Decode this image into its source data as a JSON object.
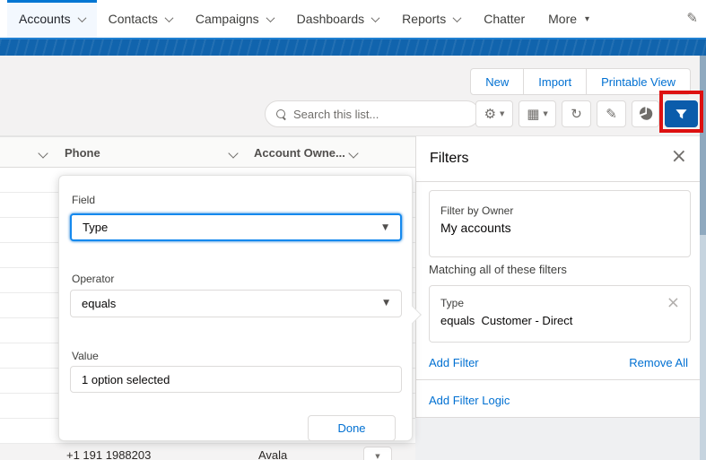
{
  "colors": {
    "brand_blue": "#0070d2",
    "band_blue": "#1164ad",
    "tab_indicator": "#0176d3",
    "highlight_red": "#dd1111",
    "filter_button_active_bg": "#0b5cab"
  },
  "nav": {
    "tabs": [
      {
        "label": "Accounts",
        "active": true
      },
      {
        "label": "Contacts",
        "active": false
      },
      {
        "label": "Campaigns",
        "active": false
      },
      {
        "label": "Dashboards",
        "active": false
      },
      {
        "label": "Reports",
        "active": false
      },
      {
        "label": "Chatter",
        "active": false
      },
      {
        "label": "More",
        "active": false
      }
    ]
  },
  "actions": {
    "new": "New",
    "import": "Import",
    "printable_view": "Printable View"
  },
  "list_controls": {
    "search_placeholder": "Search this list...",
    "icon_buttons": [
      "list-view-settings-gear",
      "display-as-table",
      "refresh",
      "inline-edit-pencil",
      "charts-pie",
      "filter-funnel"
    ]
  },
  "table": {
    "col_phone": "Phone",
    "col_owner": "Account Owne...",
    "partial_row": {
      "phone": "+1 191 1988203",
      "owner": "Avala"
    }
  },
  "popup": {
    "field_label": "Field",
    "field_value": "Type",
    "operator_label": "Operator",
    "operator_value": "equals",
    "value_label": "Value",
    "value_text": "1 option selected",
    "done": "Done"
  },
  "panel": {
    "title": "Filters",
    "owner_label": "Filter by Owner",
    "owner_value": "My accounts",
    "matching": "Matching all of these filters",
    "item_field": "Type",
    "item_condition": "equals  Customer - Direct",
    "add_filter": "Add Filter",
    "remove_all": "Remove All",
    "add_logic": "Add Filter Logic"
  },
  "icons": {
    "gear": "⚙",
    "grid": "▦",
    "refresh": "↻",
    "pencil": "✎",
    "more_arrow": "▾",
    "select_arrow": "▼",
    "tiny_arrow": "▼",
    "close": "×"
  }
}
